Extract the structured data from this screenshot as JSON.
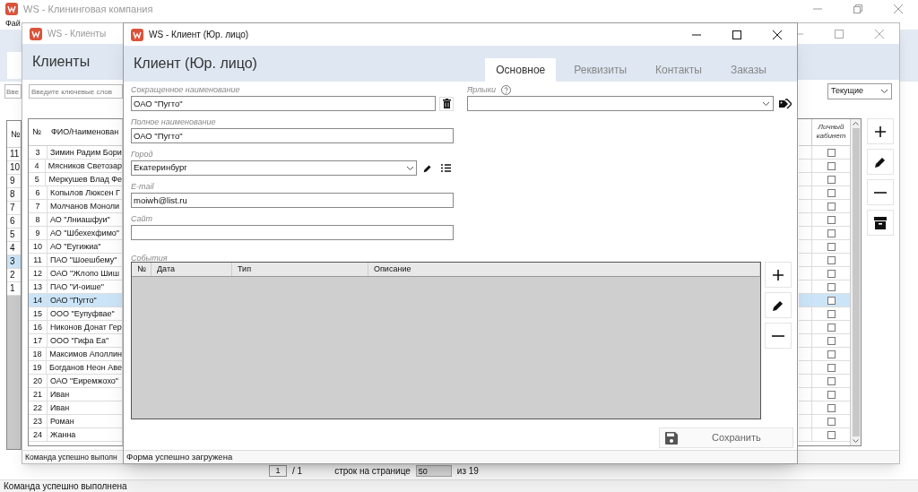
{
  "main_window": {
    "title": "WS - Клининговая компания",
    "menu": [
      "Фай"
    ],
    "search": {
      "placeholder": "Вве"
    },
    "table": {
      "columns": [
        "№"
      ],
      "rows": [
        {
          "number": "11",
          "selected": false
        },
        {
          "number": "10",
          "selected": false
        },
        {
          "number": "9",
          "selected": false
        },
        {
          "number": "8",
          "selected": false
        },
        {
          "number": "7",
          "selected": false
        },
        {
          "number": "6",
          "selected": false
        },
        {
          "number": "5",
          "selected": false
        },
        {
          "number": "4",
          "selected": false
        },
        {
          "number": "3",
          "selected": true
        },
        {
          "number": "2",
          "selected": false
        },
        {
          "number": "1",
          "selected": false
        }
      ]
    },
    "pager": {
      "page": "1",
      "page_count": "/ 1",
      "rows_label": "строк на странице",
      "rows_per_page": "50",
      "total": "из 19"
    },
    "status_bar": "Команда успешно выполнена"
  },
  "clients_window": {
    "title": "WS - Клиенты",
    "heading": "Клиенты",
    "search": {
      "placeholder": "Введите ключевые слов"
    },
    "filter": {
      "value": "Текущие"
    },
    "table": {
      "columns": [
        "№",
        "ФИО/Наименован",
        "Личный кабинет"
      ],
      "rows": [
        {
          "number": "3",
          "name": "Зимин Радим Бори",
          "personal_account": false,
          "selected": false
        },
        {
          "number": "4",
          "name": "Мясников Светозар",
          "personal_account": false,
          "selected": false
        },
        {
          "number": "5",
          "name": "Меркушев Влад Фе",
          "personal_account": false,
          "selected": false
        },
        {
          "number": "6",
          "name": "Копылов Люксен Г",
          "personal_account": false,
          "selected": false
        },
        {
          "number": "7",
          "name": "Молчанов Моноли",
          "personal_account": false,
          "selected": false
        },
        {
          "number": "8",
          "name": "АО \"Лниашфуи\"",
          "personal_account": false,
          "selected": false
        },
        {
          "number": "9",
          "name": "АО \"Шбехехфимо\"",
          "personal_account": false,
          "selected": false
        },
        {
          "number": "10",
          "name": "АО \"Еугижиа\"",
          "personal_account": false,
          "selected": false
        },
        {
          "number": "11",
          "name": "ПАО \"Шоешбему\"",
          "personal_account": false,
          "selected": false
        },
        {
          "number": "12",
          "name": "ОАО \"Жлопо Шиш",
          "personal_account": false,
          "selected": false
        },
        {
          "number": "13",
          "name": "ПАО \"И-оише\"",
          "personal_account": false,
          "selected": false
        },
        {
          "number": "14",
          "name": "ОАО \"Пугто\"",
          "personal_account": false,
          "selected": true
        },
        {
          "number": "15",
          "name": "ООО \"Еупуфвае\"",
          "personal_account": false,
          "selected": false
        },
        {
          "number": "16",
          "name": "Никонов Донат Гер",
          "personal_account": false,
          "selected": false
        },
        {
          "number": "17",
          "name": "ООО \"Гифа Еа\"",
          "personal_account": false,
          "selected": false
        },
        {
          "number": "18",
          "name": "Максимов Аполлин",
          "personal_account": false,
          "selected": false
        },
        {
          "number": "19",
          "name": "Богданов Неон Аве",
          "personal_account": false,
          "selected": false
        },
        {
          "number": "20",
          "name": "ОАО \"Еиремжохо\"",
          "personal_account": false,
          "selected": false
        },
        {
          "number": "21",
          "name": "Иван",
          "personal_account": false,
          "selected": false
        },
        {
          "number": "22",
          "name": "Иван",
          "personal_account": false,
          "selected": false
        },
        {
          "number": "23",
          "name": "Роман",
          "personal_account": false,
          "selected": false
        },
        {
          "number": "24",
          "name": "Жанна",
          "personal_account": false,
          "selected": false
        }
      ]
    },
    "status_bar": "Команда успешно выполн"
  },
  "client_dialog": {
    "title": "WS - Клиент (Юр. лицо)",
    "heading": "Клиент (Юр. лицо)",
    "tabs": [
      {
        "label": "Основное",
        "selected": true
      },
      {
        "label": "Реквизиты",
        "selected": false
      },
      {
        "label": "Контакты",
        "selected": false
      },
      {
        "label": "Заказы",
        "selected": false
      }
    ],
    "fields": [
      {
        "label": "Сокращенное наименование",
        "value": "ОАО \"Пугто\"",
        "kind": "text_delete"
      },
      {
        "label": "Полное наименование",
        "value": "ОАО \"Пугто\"",
        "kind": "text"
      },
      {
        "label": "Город",
        "value": "Екатеринбург",
        "kind": "select_edit"
      },
      {
        "label": "E-mail",
        "value": "moiwh@list.ru",
        "kind": "text"
      },
      {
        "label": "Сайт",
        "kind": "text"
      }
    ],
    "tags": {
      "label": "Ярлыки"
    },
    "events": {
      "label": "События",
      "columns": [
        "№",
        "Дата",
        "Тип",
        "Описание"
      ]
    },
    "save_button": "Сохранить",
    "status_bar": "Форма успешно загружена"
  }
}
